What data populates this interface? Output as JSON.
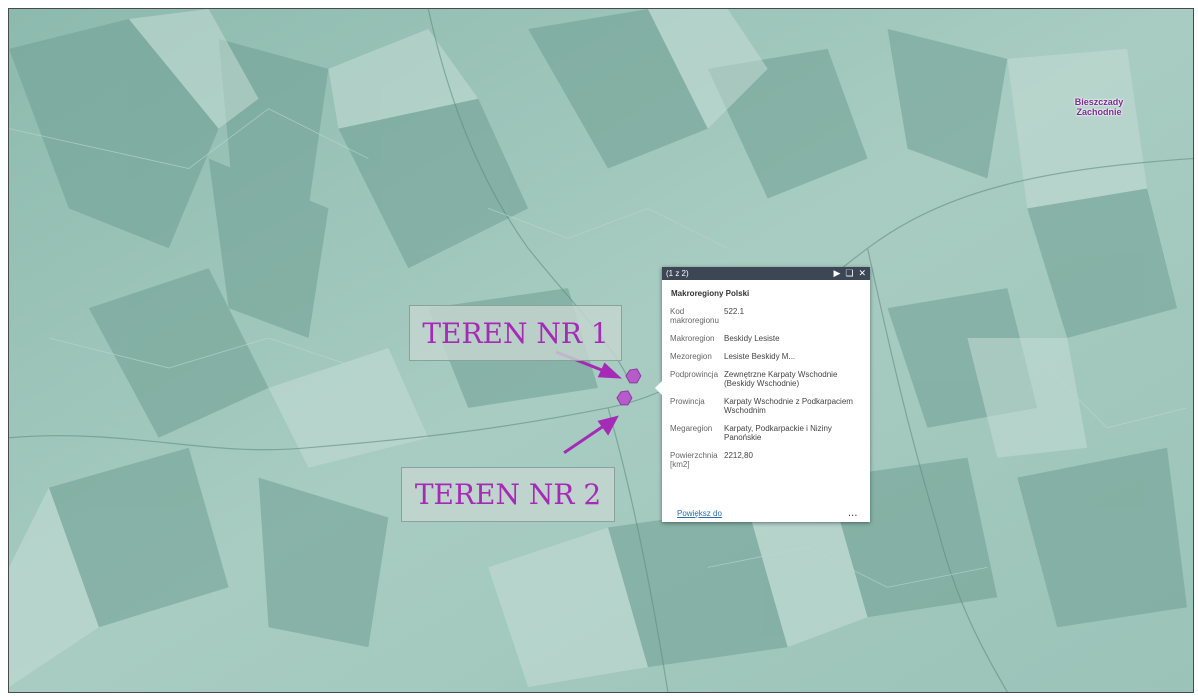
{
  "map": {
    "region_label": "Bieszczady Zachodnie"
  },
  "annotations": {
    "teren1": "TEREN NR 1",
    "teren2": "TEREN NR 2"
  },
  "colors": {
    "annotation_text": "#a52bb6",
    "marker": "#b65bc9",
    "popup_header": "#3d4654"
  },
  "popup": {
    "count": "(1 z 2)",
    "icons": [
      "next-icon",
      "maximize-icon",
      "close-icon"
    ],
    "title": "Makroregiony Polski",
    "fields": [
      {
        "label": "Kod makroregionu",
        "value": "522.1"
      },
      {
        "label": "Makroregion",
        "value": "Beskidy Lesiste"
      },
      {
        "label": "Mezoregion",
        "value": "Lesiste Beskidy M..."
      },
      {
        "label": "Podprowincja",
        "value": "Zewnętrzne Karpaty Wschodnie (Beskidy Wschodnie)"
      },
      {
        "label": "Prowincja",
        "value": "Karpaty Wschodnie z Podkarpaciem Wschodnim"
      },
      {
        "label": "Megaregion",
        "value": "Karpaty, Podkarpackie i Niziny Panońskie"
      },
      {
        "label": "Powierzchnia [km2]",
        "value": "2212,80"
      }
    ],
    "link": "Powiększ do",
    "more": "..."
  }
}
